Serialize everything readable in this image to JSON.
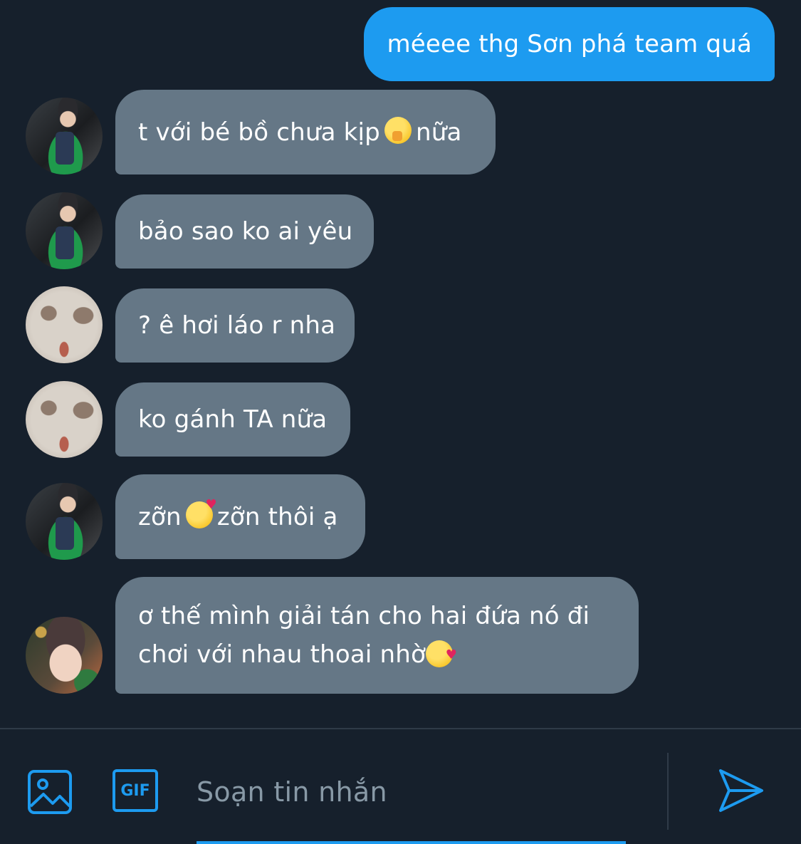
{
  "messages": {
    "outgoing": "méeee thg Sơn phá team quá",
    "incoming": [
      {
        "avatar": "boy-green-sweater-avatar",
        "before": "t với bé bồ chưa kịp",
        "emoji": "shushing-face-emoji",
        "after": "nữa"
      },
      {
        "avatar": "boy-green-sweater-avatar",
        "text": "bảo sao ko ai yêu"
      },
      {
        "avatar": "ghost-mask-avatar",
        "text": "? ê hơi láo r nha"
      },
      {
        "avatar": "ghost-mask-avatar",
        "text": "ko gánh TA nữa"
      },
      {
        "avatar": "boy-green-sweater-avatar",
        "before": "zỡn",
        "emoji": "smiling-face-with-hearts-emoji",
        "after": "zỡn thôi ạ"
      },
      {
        "avatar": "girl-avatar",
        "line1": "ơ thế mình giải tán cho hai đứa nó đi",
        "line2": "chơi với nhau thoai nhờ",
        "emoji": "smiling-face-with-hearts-emoji"
      }
    ]
  },
  "composer": {
    "placeholder": "Soạn tin nhắn",
    "gif_label": "GIF",
    "image_icon": "image-icon",
    "send_icon": "send-icon"
  },
  "colors": {
    "background": "#16202c",
    "outgoing_bubble": "#1d9bf0",
    "incoming_bubble": "#657786",
    "accent": "#1d9bf0",
    "placeholder_text": "#8899a6"
  }
}
